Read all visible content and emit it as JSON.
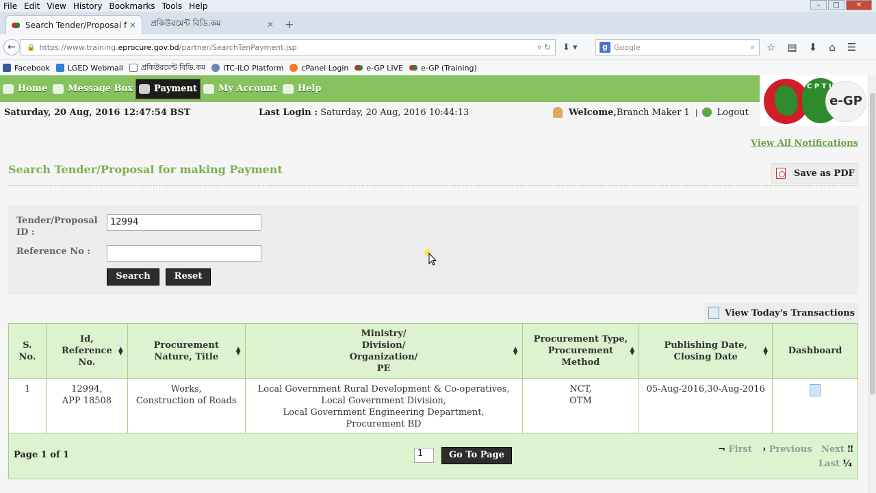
{
  "browser": {
    "menu": [
      "File",
      "Edit",
      "View",
      "History",
      "Bookmarks",
      "Tools",
      "Help"
    ],
    "tabs": [
      {
        "label": "Search Tender/Proposal fo..."
      },
      {
        "label": "প্রকিউরমেন্ট বিডি.কম"
      }
    ],
    "url_prefix": "https://www.training.",
    "url_domain": "eprocure.gov.bd",
    "url_suffix": "/partner/SearchTenPayment.jsp",
    "search_placeholder": "Google",
    "bookmarks": [
      "Facebook",
      "LGED Webmail",
      "প্রকিউরমেন্ট বিডি.কম",
      "ITC-ILO Platform",
      "cPanel Login",
      "e-GP LIVE",
      "e-GP (Training)"
    ]
  },
  "nav": {
    "home": "Home",
    "message_box": "Message Box",
    "payment": "Payment",
    "my_account": "My Account",
    "help": "Help"
  },
  "logo": {
    "letters": "C P T U",
    "egp": "e-GP"
  },
  "info": {
    "datetime": "Saturday, 20 Aug, 2016 12:47:54 BST",
    "last_login_label": "Last Login :",
    "last_login_value": " Saturday, 20 Aug, 2016 10:44:13",
    "welcome_label": "Welcome,",
    "welcome_user": " Branch Maker 1",
    "separator": "|",
    "logout": "Logout"
  },
  "view_notifications": "View All Notifications",
  "title": "Search Tender/Proposal for making Payment",
  "save_pdf": "Save as PDF",
  "form": {
    "tender_id_label": "Tender/Proposal ID :",
    "tender_id_value": "12994",
    "reference_label": "Reference No :",
    "reference_value": "",
    "search_button": "Search",
    "reset_button": "Reset"
  },
  "today_transactions": "View Today's Transactions",
  "table": {
    "headers": [
      "S. No.",
      "Id, Reference No.",
      "Procurement Nature, Title",
      "Ministry/ Division/ Organization/ PE",
      "Procurement Type, Procurement Method",
      "Publishing Date, Closing Date",
      "Dashboard"
    ],
    "rows": [
      {
        "sno": "1",
        "id_line1": "12994,",
        "id_line2": "APP 18508",
        "nature_line1": "Works,",
        "nature_line2": "Construction of Roads",
        "ministry_line1": "Local Government Rural Development & Co-operatives,",
        "ministry_line2": "Local Government Division,",
        "ministry_line3": "Local Government Engineering Department,",
        "ministry_line4": "Procurement BD",
        "type_line1": "NCT,",
        "type_line2": "OTM",
        "dates": "05-Aug-2016,30-Aug-2016"
      }
    ]
  },
  "pager": {
    "page_of": "Page 1 of 1",
    "page_input": "1",
    "go_button": "Go To Page",
    "first": "First",
    "previous": "Previous",
    "next": "Next",
    "last": "Last"
  },
  "colors": {
    "nav_green": "#86c25d",
    "header_green": "#ddf2cf",
    "title_green": "#7bb04f",
    "button_dark": "#2d2d2d"
  }
}
